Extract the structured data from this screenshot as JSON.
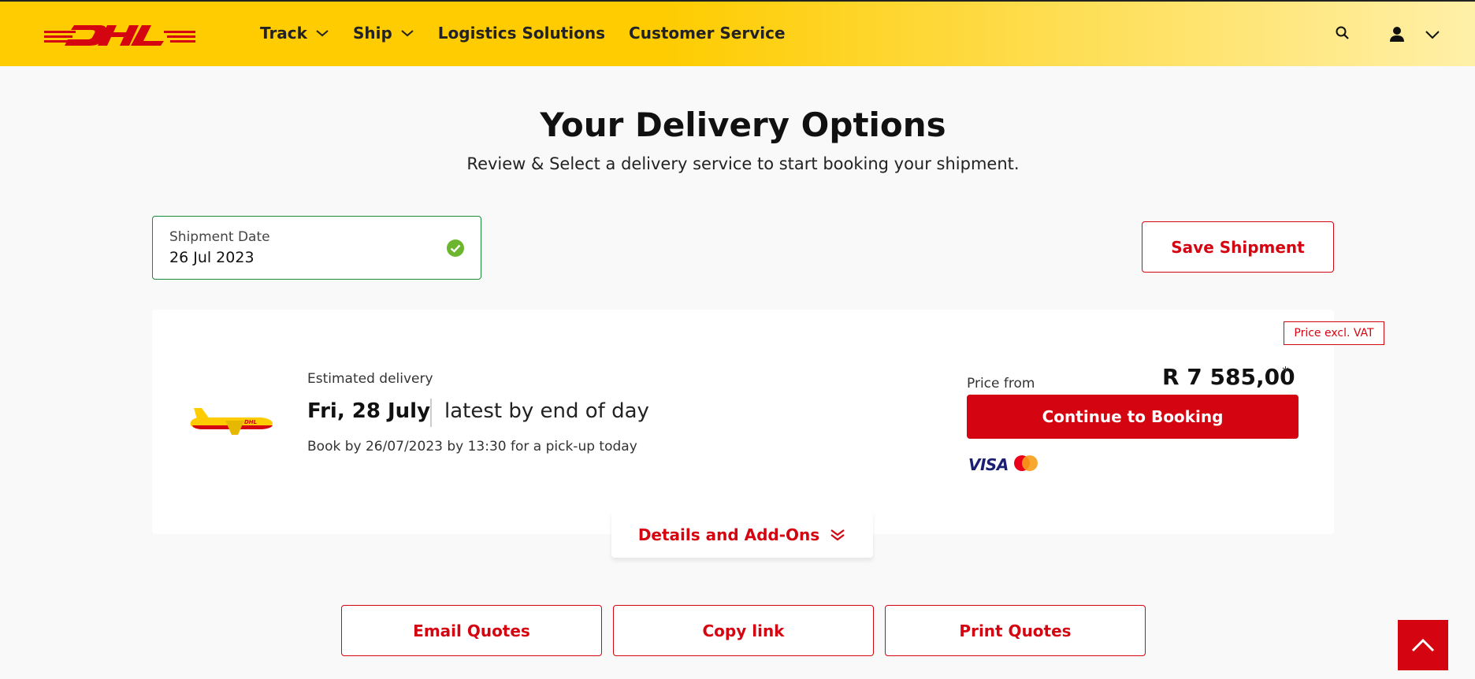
{
  "header": {
    "logo_text": "DHL",
    "nav": [
      {
        "label": "Track",
        "has_dropdown": true
      },
      {
        "label": "Ship",
        "has_dropdown": true
      },
      {
        "label": "Logistics Solutions",
        "has_dropdown": false
      },
      {
        "label": "Customer Service",
        "has_dropdown": false
      }
    ],
    "icons": [
      "search-icon",
      "user-icon",
      "chevron-down-icon"
    ]
  },
  "page": {
    "title": "Your Delivery Options",
    "subtitle": "Review & Select a delivery service to start booking your shipment."
  },
  "shipment_date": {
    "label": "Shipment Date",
    "value": "26 Jul 2023",
    "status": "valid"
  },
  "save_button": "Save Shipment",
  "offer": {
    "vat_badge": "Price excl. VAT",
    "estimated_label": "Estimated delivery",
    "delivery_date": "Fri, 28 July",
    "delivery_time": "latest by end of day",
    "book_by": "Book by 26/07/2023 by 13:30 for a pick-up today",
    "price_from_label": "Price from",
    "price": "R 7 585,00",
    "price_note_marker": "*",
    "continue_button": "Continue to Booking",
    "payment_methods": [
      "VISA",
      "mastercard"
    ],
    "details_label": "Details and Add-Ons"
  },
  "bottom_actions": {
    "email": "Email Quotes",
    "copy": "Copy link",
    "print": "Print Quotes"
  },
  "colors": {
    "brand_yellow": "#fecc00",
    "brand_red": "#d40511",
    "success_green": "#6cb52e"
  }
}
